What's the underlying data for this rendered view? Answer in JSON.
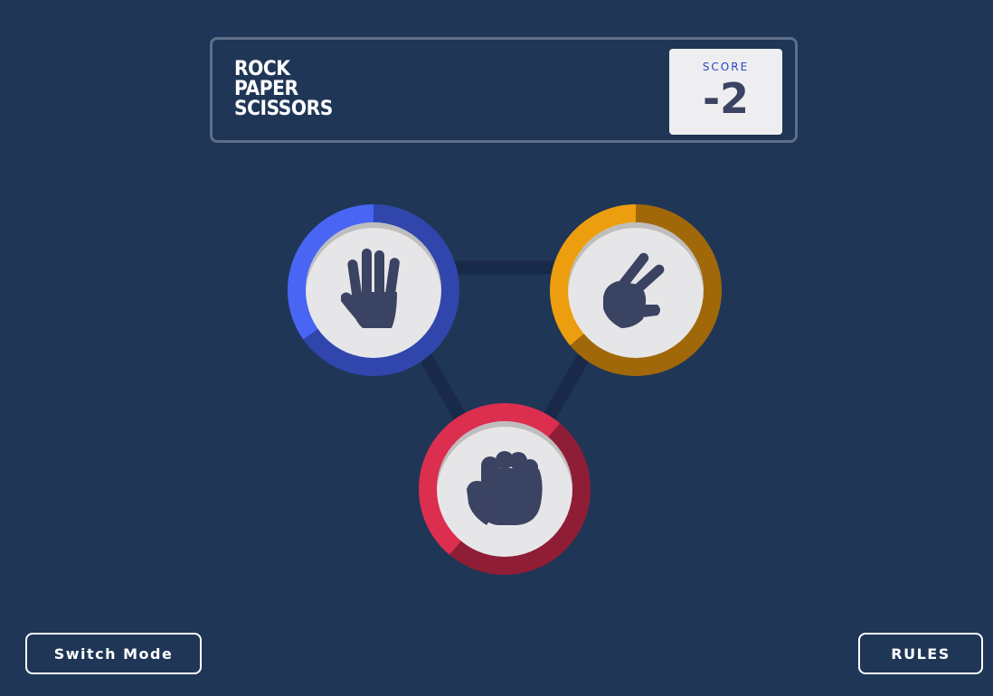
{
  "header": {
    "title_lines": [
      "ROCK",
      "PAPER",
      "SCISSORS"
    ]
  },
  "score": {
    "label": "SCORE",
    "value": "-2"
  },
  "choices": [
    {
      "id": "paper",
      "icon": "paper-hand-icon",
      "colors": {
        "light": "#4865f4",
        "dark": "#3046ad"
      }
    },
    {
      "id": "scissors",
      "icon": "scissors-hand-icon",
      "colors": {
        "light": "#ec9e0e",
        "dark": "#a1680a"
      }
    },
    {
      "id": "rock",
      "icon": "rock-fist-icon",
      "colors": {
        "light": "#dc2e4e",
        "dark": "#8f1d35"
      }
    }
  ],
  "buttons": {
    "switch_mode": "Switch Mode",
    "rules": "RULES"
  },
  "colors": {
    "background": "#1f3656",
    "header_border": "#5f6f8a",
    "score_label": "#2a45c2",
    "score_value": "#3b4363",
    "icon": "#3b4363"
  }
}
